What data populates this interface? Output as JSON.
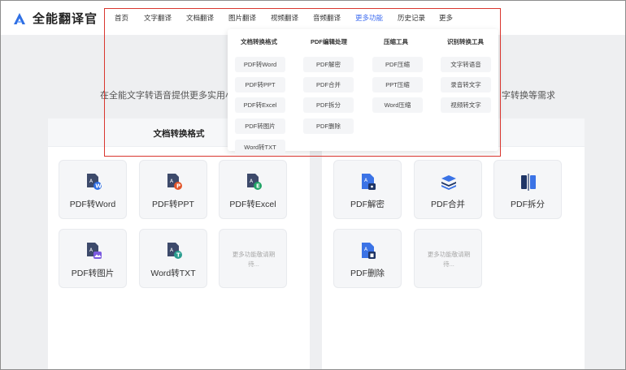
{
  "app": {
    "name": "全能翻译官"
  },
  "nav": {
    "items": [
      {
        "label": "首页"
      },
      {
        "label": "文字翻译"
      },
      {
        "label": "文档翻译"
      },
      {
        "label": "图片翻译"
      },
      {
        "label": "视频翻译"
      },
      {
        "label": "音频翻译"
      },
      {
        "label": "更多功能"
      },
      {
        "label": "历史记录"
      },
      {
        "label": "更多"
      }
    ],
    "active": "更多功能"
  },
  "hero": {
    "left": "在全能文字转语音提供更多实用小",
    "right": "字转换等需求"
  },
  "panels": {
    "left": {
      "title": "文档转换格式",
      "cards": [
        {
          "label": "PDF转Word",
          "icon": "pdf-to-word-icon"
        },
        {
          "label": "PDF转PPT",
          "icon": "pdf-to-ppt-icon"
        },
        {
          "label": "PDF转Excel",
          "icon": "pdf-to-excel-icon"
        },
        {
          "label": "PDF转图片",
          "icon": "pdf-to-image-icon"
        },
        {
          "label": "Word转TXT",
          "icon": "word-to-txt-icon"
        }
      ],
      "placeholder": "更多功能敬请期待..."
    },
    "right": {
      "cards": [
        {
          "label": "PDF解密",
          "icon": "pdf-decrypt-icon"
        },
        {
          "label": "PDF合并",
          "icon": "pdf-merge-icon"
        },
        {
          "label": "PDF拆分",
          "icon": "pdf-split-icon"
        },
        {
          "label": "PDF删除",
          "icon": "pdf-delete-icon"
        }
      ],
      "placeholder": "更多功能敬请期待..."
    }
  },
  "dropdown": {
    "columns": [
      {
        "title": "文档转换格式",
        "items": [
          "PDF转Word",
          "PDF转PPT",
          "PDF转Excel",
          "PDF转图片",
          "Word转TXT"
        ]
      },
      {
        "title": "PDF编辑处理",
        "items": [
          "PDF解密",
          "PDF合并",
          "PDF拆分",
          "PDF删除"
        ]
      },
      {
        "title": "压缩工具",
        "items": [
          "PDF压缩",
          "PPT压缩",
          "Word压缩"
        ]
      },
      {
        "title": "识别转换工具",
        "items": [
          "文字转语音",
          "录音转文字",
          "视频转文字"
        ]
      }
    ]
  },
  "colors": {
    "accent": "#3d6cf0",
    "highlight": "#d9362f",
    "word": "#2f6fe4",
    "ppt": "#e2572c",
    "excel": "#21a366",
    "image": "#7c5ce0",
    "txt": "#2a9d8f"
  }
}
